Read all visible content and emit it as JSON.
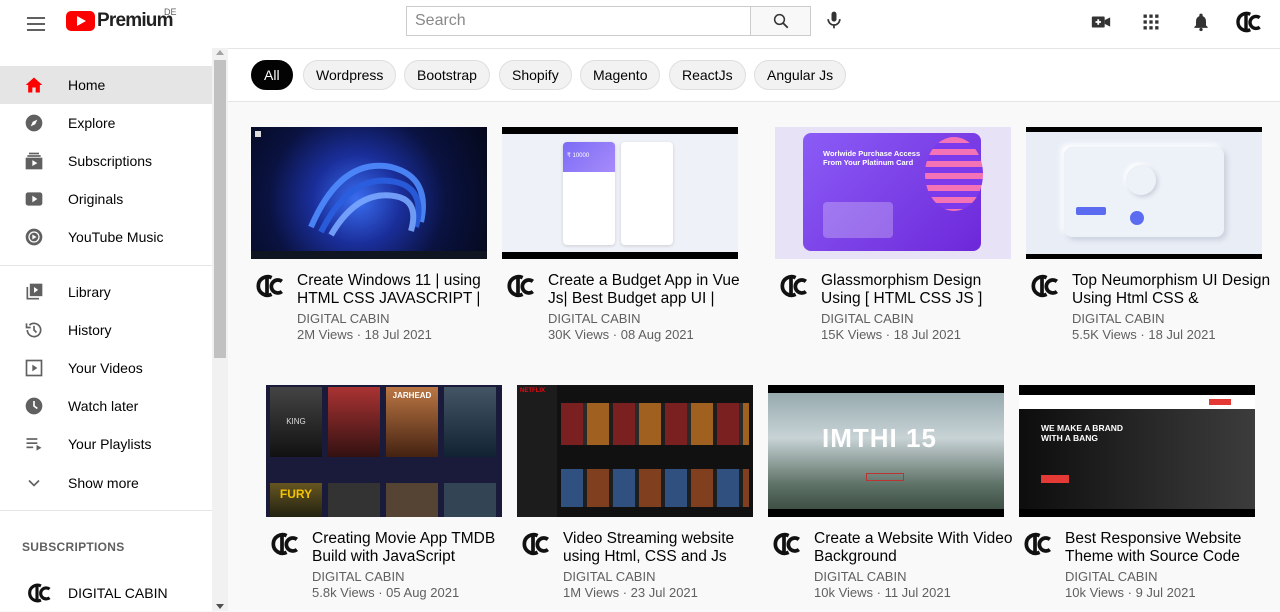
{
  "header": {
    "logo_text": "Premium",
    "region": "DE",
    "search_placeholder": "Search",
    "icons": [
      "menu-icon",
      "create-video-icon",
      "apps-icon",
      "notifications-icon",
      "account-avatar"
    ]
  },
  "sidebar": {
    "main": [
      {
        "label": "Home",
        "icon": "home-icon",
        "active": true
      },
      {
        "label": "Explore",
        "icon": "explore-icon"
      },
      {
        "label": "Subscriptions",
        "icon": "subscriptions-icon"
      },
      {
        "label": "Originals",
        "icon": "originals-icon"
      },
      {
        "label": "YouTube Music",
        "icon": "music-icon"
      }
    ],
    "library": [
      {
        "label": "Library",
        "icon": "library-icon"
      },
      {
        "label": "History",
        "icon": "history-icon"
      },
      {
        "label": "Your Videos",
        "icon": "your-videos-icon"
      },
      {
        "label": "Watch later",
        "icon": "watch-later-icon"
      },
      {
        "label": "Your Playlists",
        "icon": "playlists-icon"
      },
      {
        "label": "Show more",
        "icon": "chevron-down-icon"
      }
    ],
    "subscriptions_heading": "SUBSCRIPTIONS",
    "subscriptions": [
      {
        "label": "DIGITAL CABIN"
      }
    ]
  },
  "chips": [
    "All",
    "Wordpress",
    "Bootstrap",
    "Shopify",
    "Magento",
    "ReactJs",
    "Angular Js"
  ],
  "videos": [
    {
      "title": "Create Windows 11 | using HTML CSS JAVASCRIPT |",
      "channel": "DIGITAL CABIN",
      "stats": "2M Views · 18 Jul 2021"
    },
    {
      "title": "Create a Budget App in Vue Js| Best Budget app UI |",
      "channel": "DIGITAL CABIN",
      "stats": "30K Views · 08 Aug 2021"
    },
    {
      "title": "Glassmorphism Design Using [ HTML CSS JS ]",
      "channel": "DIGITAL CABIN",
      "stats": "15K Views · 18 Jul 2021"
    },
    {
      "title": "Top Neumorphism UI Design Using Html CSS & Javascript",
      "channel": "DIGITAL CABIN",
      "stats": "5.5K Views · 18 Jul 2021"
    },
    {
      "title": "Creating Movie App TMDB Build with JavaScript",
      "channel": "DIGITAL CABIN",
      "stats": "5.8k Views · 05 Aug 2021"
    },
    {
      "title": "Video Streaming website using Html, CSS and Js",
      "channel": "DIGITAL CABIN",
      "stats": "1M Views · 23 Jul 2021"
    },
    {
      "title": "Create a Website With Video Background",
      "channel": "DIGITAL CABIN",
      "stats": "10k Views · 11 Jul 2021"
    },
    {
      "title": "Best Responsive Website Theme with Source Code",
      "channel": "DIGITAL CABIN",
      "stats": "10k Views · 9 Jul 2021"
    }
  ],
  "thumb_text": {
    "glass_title": "Worlwide Purchase Access From Your Platinum Card",
    "budget_amount": "₹ 10000",
    "movie_titles": [
      "KING",
      "JARHEAD",
      "FURY"
    ],
    "netflix_logo": "NETFLIX",
    "video_bg_word": "IMTHI 15",
    "responsive_headline": "WE MAKE A BRAND WITH A BANG"
  },
  "colors": {
    "brand_red": "#ff0000",
    "active_chip": "#030303",
    "sidebar_active": "#e5e5e5"
  }
}
